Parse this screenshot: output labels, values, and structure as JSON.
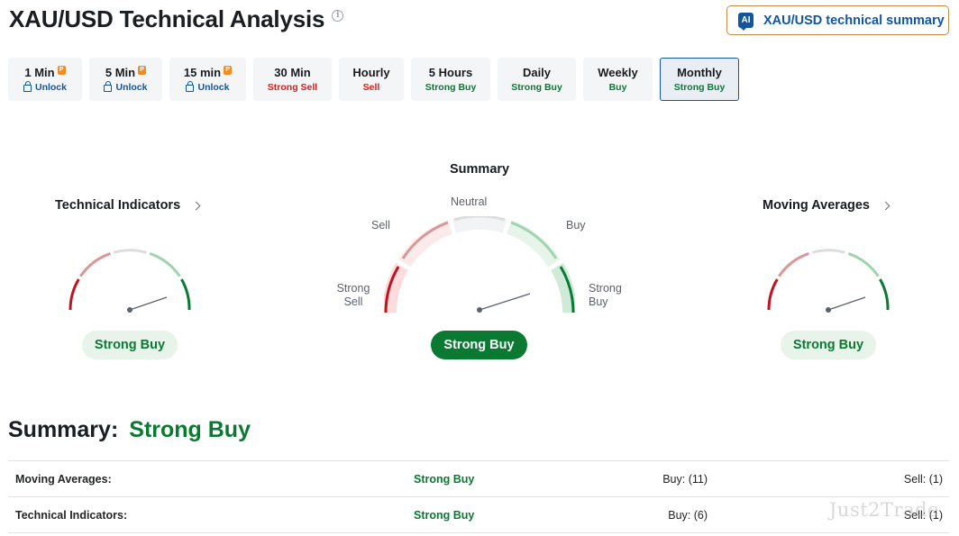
{
  "header": {
    "title": "XAU/USD Technical Analysis",
    "info_icon": "info-icon",
    "ai_button": {
      "badge": "AI",
      "label": "XAU/USD technical summary"
    }
  },
  "timeframes": [
    {
      "label": "1 Min",
      "status": "Unlock",
      "locked": true
    },
    {
      "label": "5 Min",
      "status": "Unlock",
      "locked": true
    },
    {
      "label": "15 min",
      "status": "Unlock",
      "locked": true
    },
    {
      "label": "30 Min",
      "status": "Strong Sell",
      "locked": false
    },
    {
      "label": "Hourly",
      "status": "Sell",
      "locked": false
    },
    {
      "label": "5 Hours",
      "status": "Strong Buy",
      "locked": false
    },
    {
      "label": "Daily",
      "status": "Strong Buy",
      "locked": false
    },
    {
      "label": "Weekly",
      "status": "Buy",
      "locked": false
    },
    {
      "label": "Monthly",
      "status": "Strong Buy",
      "locked": false,
      "active": true
    }
  ],
  "gauges": {
    "technical": {
      "title": "Technical Indicators",
      "result": "Strong Buy"
    },
    "summary": {
      "title": "Summary",
      "result": "Strong Buy",
      "labels": {
        "strong_sell": "Strong Sell",
        "sell": "Sell",
        "neutral": "Neutral",
        "buy": "Buy",
        "strong_buy": "Strong Buy"
      }
    },
    "moving": {
      "title": "Moving Averages",
      "result": "Strong Buy"
    }
  },
  "summary": {
    "label": "Summary:",
    "value": "Strong Buy",
    "rows": [
      {
        "name": "Moving Averages:",
        "status": "Strong Buy",
        "buy": "Buy: (11)",
        "sell": "Sell: (1)"
      },
      {
        "name": "Technical Indicators:",
        "status": "Strong Buy",
        "buy": "Buy: (6)",
        "sell": "Sell: (1)"
      }
    ]
  },
  "watermark": "Just2Trade",
  "colors": {
    "accent_blue": "#1256a0",
    "strong_buy_green": "#0a7a33",
    "sell_red": "#d91e18",
    "pro_orange": "#f28c1e",
    "ai_border": "#c48a4a"
  }
}
